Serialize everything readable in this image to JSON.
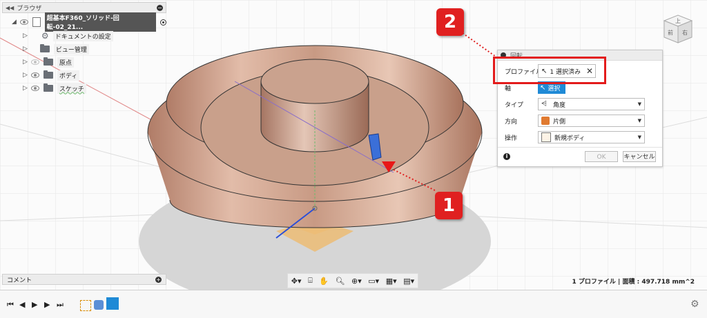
{
  "browser": {
    "title": "ブラウザ",
    "document_name": "超基本F360_ソリッド-回転-02_21...",
    "items": [
      {
        "label": "ドキュメントの設定",
        "icon": "gear-icon"
      },
      {
        "label": "ビュー管理",
        "icon": "folder-icon"
      },
      {
        "label": "原点",
        "icon": "folder-icon"
      },
      {
        "label": "ボディ",
        "icon": "folder-icon"
      },
      {
        "label": "スケッチ",
        "icon": "folder-icon"
      }
    ]
  },
  "comment_bar": {
    "label": "コメント"
  },
  "dialog": {
    "title": "回転",
    "rows": {
      "profile": {
        "label": "プロファイル",
        "value": "1 選択済み"
      },
      "axis": {
        "label": "軸",
        "value": "選択"
      },
      "type": {
        "label": "タイプ",
        "value": "角度"
      },
      "direction": {
        "label": "方向",
        "value": "片側"
      },
      "operation": {
        "label": "操作",
        "value": "新規ボディ"
      }
    },
    "ok_label": "OK",
    "cancel_label": "キャンセル"
  },
  "callouts": {
    "one": "1",
    "two": "2"
  },
  "status": {
    "text": "1 プロファイル | 面積 : 497.718 mm^2"
  },
  "viewcube": {
    "top": "上",
    "front": "前",
    "right": "右"
  },
  "colors": {
    "accent": "#1f8ad6",
    "callout": "#e02020",
    "body": "#c89a84"
  }
}
